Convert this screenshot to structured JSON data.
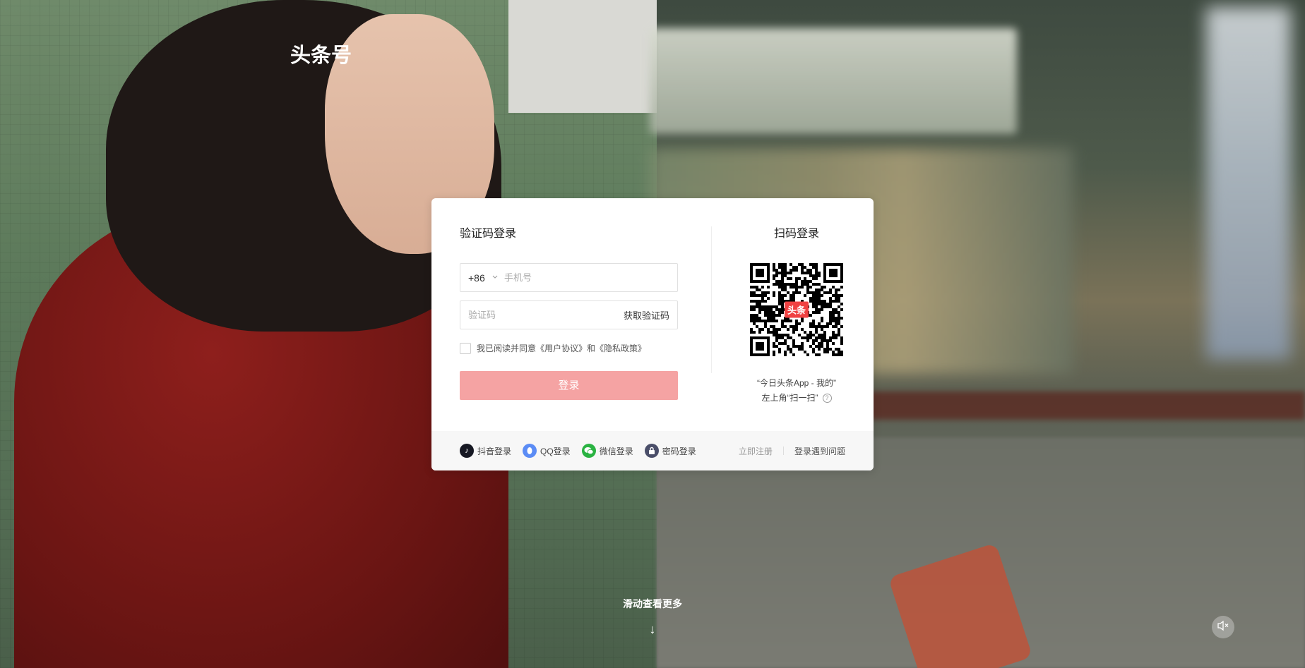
{
  "logo": {
    "text": "头条号"
  },
  "login": {
    "title": "验证码登录",
    "country_code": "+86",
    "phone_placeholder": "手机号",
    "code_placeholder": "验证码",
    "get_code_label": "获取验证码",
    "agreement_text": "我已阅读并同意《用户协议》和《隐私政策》",
    "submit_label": "登录"
  },
  "qr": {
    "title": "扫码登录",
    "badge": "头条",
    "hint_line1": "“今日头条App - 我的”",
    "hint_line2": "左上角“扫一扫”",
    "help_glyph": "?"
  },
  "footer": {
    "socials": [
      {
        "label": "抖音登录",
        "icon": "douyin-icon"
      },
      {
        "label": "QQ登录",
        "icon": "qq-icon"
      },
      {
        "label": "微信登录",
        "icon": "wechat-icon"
      },
      {
        "label": "密码登录",
        "icon": "lock-icon"
      }
    ],
    "register_label": "立即注册",
    "problem_label": "登录遇到问题"
  },
  "scroll": {
    "hint": "滑动查看更多",
    "arrow": "↓"
  },
  "colors": {
    "brand_red": "#f04142",
    "login_button": "#f5a3a3"
  }
}
